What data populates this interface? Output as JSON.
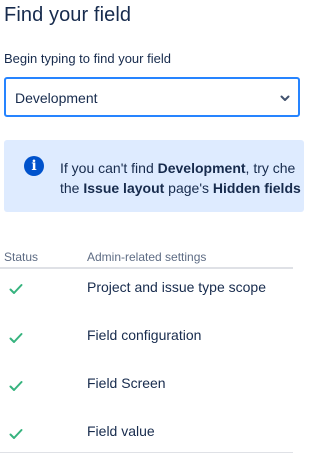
{
  "title": "Find your field",
  "search": {
    "label": "Begin typing to find your field",
    "value": "Development"
  },
  "banner": {
    "icon": "info-icon",
    "line1_pre": "If you can't find ",
    "line1_bold": "Development",
    "line1_post": ", try che",
    "line2_pre": "the ",
    "line2_bold1": "Issue layout",
    "line2_mid": " page's ",
    "line2_bold2": "Hidden fields"
  },
  "table": {
    "headers": {
      "status": "Status",
      "settings": "Admin-related settings"
    },
    "rows": [
      {
        "status_icon": "check-icon",
        "label": "Project and issue type scope"
      },
      {
        "status_icon": "check-icon",
        "label": "Field configuration"
      },
      {
        "status_icon": "check-icon",
        "label": "Field Screen"
      },
      {
        "status_icon": "check-icon",
        "label": "Field value"
      }
    ]
  },
  "colors": {
    "accent": "#2684ff",
    "info": "#0052cc",
    "banner_bg": "#deebff",
    "success": "#36b37e"
  }
}
